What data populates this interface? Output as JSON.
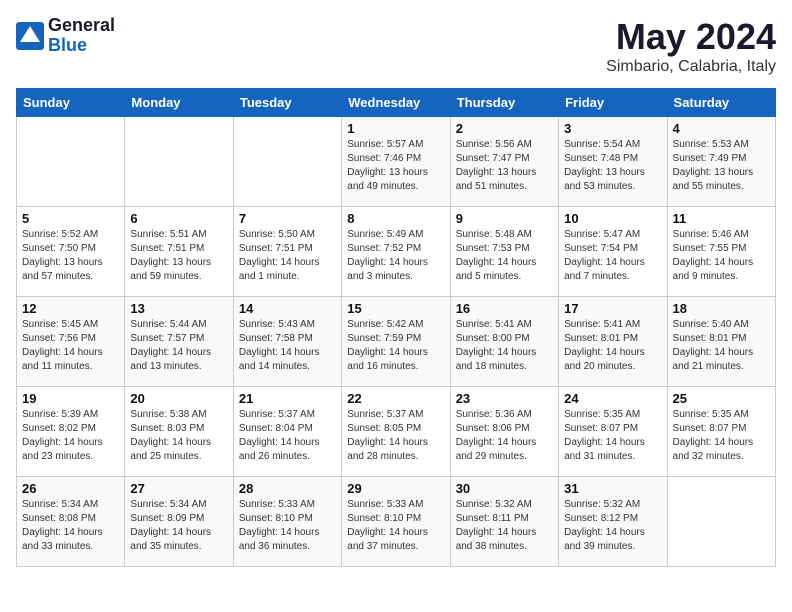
{
  "header": {
    "logo_general": "General",
    "logo_blue": "Blue",
    "title": "May 2024",
    "subtitle": "Simbario, Calabria, Italy"
  },
  "calendar": {
    "days_of_week": [
      "Sunday",
      "Monday",
      "Tuesday",
      "Wednesday",
      "Thursday",
      "Friday",
      "Saturday"
    ],
    "weeks": [
      [
        {
          "day": "",
          "info": ""
        },
        {
          "day": "",
          "info": ""
        },
        {
          "day": "",
          "info": ""
        },
        {
          "day": "1",
          "info": "Sunrise: 5:57 AM\nSunset: 7:46 PM\nDaylight: 13 hours\nand 49 minutes."
        },
        {
          "day": "2",
          "info": "Sunrise: 5:56 AM\nSunset: 7:47 PM\nDaylight: 13 hours\nand 51 minutes."
        },
        {
          "day": "3",
          "info": "Sunrise: 5:54 AM\nSunset: 7:48 PM\nDaylight: 13 hours\nand 53 minutes."
        },
        {
          "day": "4",
          "info": "Sunrise: 5:53 AM\nSunset: 7:49 PM\nDaylight: 13 hours\nand 55 minutes."
        }
      ],
      [
        {
          "day": "5",
          "info": "Sunrise: 5:52 AM\nSunset: 7:50 PM\nDaylight: 13 hours\nand 57 minutes."
        },
        {
          "day": "6",
          "info": "Sunrise: 5:51 AM\nSunset: 7:51 PM\nDaylight: 13 hours\nand 59 minutes."
        },
        {
          "day": "7",
          "info": "Sunrise: 5:50 AM\nSunset: 7:51 PM\nDaylight: 14 hours\nand 1 minute."
        },
        {
          "day": "8",
          "info": "Sunrise: 5:49 AM\nSunset: 7:52 PM\nDaylight: 14 hours\nand 3 minutes."
        },
        {
          "day": "9",
          "info": "Sunrise: 5:48 AM\nSunset: 7:53 PM\nDaylight: 14 hours\nand 5 minutes."
        },
        {
          "day": "10",
          "info": "Sunrise: 5:47 AM\nSunset: 7:54 PM\nDaylight: 14 hours\nand 7 minutes."
        },
        {
          "day": "11",
          "info": "Sunrise: 5:46 AM\nSunset: 7:55 PM\nDaylight: 14 hours\nand 9 minutes."
        }
      ],
      [
        {
          "day": "12",
          "info": "Sunrise: 5:45 AM\nSunset: 7:56 PM\nDaylight: 14 hours\nand 11 minutes."
        },
        {
          "day": "13",
          "info": "Sunrise: 5:44 AM\nSunset: 7:57 PM\nDaylight: 14 hours\nand 13 minutes."
        },
        {
          "day": "14",
          "info": "Sunrise: 5:43 AM\nSunset: 7:58 PM\nDaylight: 14 hours\nand 14 minutes."
        },
        {
          "day": "15",
          "info": "Sunrise: 5:42 AM\nSunset: 7:59 PM\nDaylight: 14 hours\nand 16 minutes."
        },
        {
          "day": "16",
          "info": "Sunrise: 5:41 AM\nSunset: 8:00 PM\nDaylight: 14 hours\nand 18 minutes."
        },
        {
          "day": "17",
          "info": "Sunrise: 5:41 AM\nSunset: 8:01 PM\nDaylight: 14 hours\nand 20 minutes."
        },
        {
          "day": "18",
          "info": "Sunrise: 5:40 AM\nSunset: 8:01 PM\nDaylight: 14 hours\nand 21 minutes."
        }
      ],
      [
        {
          "day": "19",
          "info": "Sunrise: 5:39 AM\nSunset: 8:02 PM\nDaylight: 14 hours\nand 23 minutes."
        },
        {
          "day": "20",
          "info": "Sunrise: 5:38 AM\nSunset: 8:03 PM\nDaylight: 14 hours\nand 25 minutes."
        },
        {
          "day": "21",
          "info": "Sunrise: 5:37 AM\nSunset: 8:04 PM\nDaylight: 14 hours\nand 26 minutes."
        },
        {
          "day": "22",
          "info": "Sunrise: 5:37 AM\nSunset: 8:05 PM\nDaylight: 14 hours\nand 28 minutes."
        },
        {
          "day": "23",
          "info": "Sunrise: 5:36 AM\nSunset: 8:06 PM\nDaylight: 14 hours\nand 29 minutes."
        },
        {
          "day": "24",
          "info": "Sunrise: 5:35 AM\nSunset: 8:07 PM\nDaylight: 14 hours\nand 31 minutes."
        },
        {
          "day": "25",
          "info": "Sunrise: 5:35 AM\nSunset: 8:07 PM\nDaylight: 14 hours\nand 32 minutes."
        }
      ],
      [
        {
          "day": "26",
          "info": "Sunrise: 5:34 AM\nSunset: 8:08 PM\nDaylight: 14 hours\nand 33 minutes."
        },
        {
          "day": "27",
          "info": "Sunrise: 5:34 AM\nSunset: 8:09 PM\nDaylight: 14 hours\nand 35 minutes."
        },
        {
          "day": "28",
          "info": "Sunrise: 5:33 AM\nSunset: 8:10 PM\nDaylight: 14 hours\nand 36 minutes."
        },
        {
          "day": "29",
          "info": "Sunrise: 5:33 AM\nSunset: 8:10 PM\nDaylight: 14 hours\nand 37 minutes."
        },
        {
          "day": "30",
          "info": "Sunrise: 5:32 AM\nSunset: 8:11 PM\nDaylight: 14 hours\nand 38 minutes."
        },
        {
          "day": "31",
          "info": "Sunrise: 5:32 AM\nSunset: 8:12 PM\nDaylight: 14 hours\nand 39 minutes."
        },
        {
          "day": "",
          "info": ""
        }
      ]
    ]
  }
}
